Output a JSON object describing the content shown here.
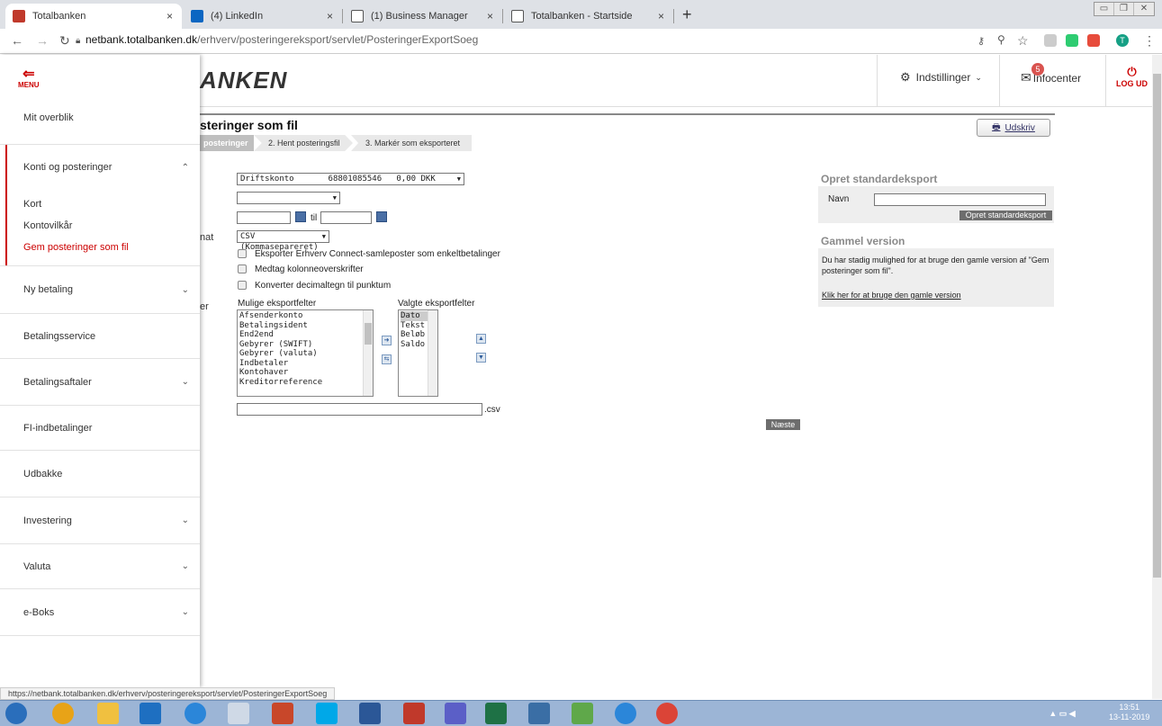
{
  "browser": {
    "tabs": [
      {
        "label": "Totalbanken",
        "color": "#c0392b"
      },
      {
        "label": "(4) LinkedIn",
        "color": "#0a66c2"
      },
      {
        "label": "(1) Business Manager",
        "color": "#555555"
      },
      {
        "label": "Totalbanken - Startside",
        "color": "#555555"
      }
    ],
    "close_glyph": "×",
    "new_tab": "+",
    "url_host": "netbank.totalbanken.dk",
    "url_path": "/erhverv/posteringereksport/servlet/PosteringerExportSoeg",
    "profile_initial": "T"
  },
  "header": {
    "logo": "ANKEN",
    "settings_label": "Indstillinger",
    "infocenter_label": "Infocenter",
    "infocenter_count": "5",
    "logout_label": "LOG UD",
    "menu_label": "MENU"
  },
  "sidebar": {
    "items": [
      {
        "label": "Mit overblik"
      },
      {
        "label": "Konti og posteringer"
      },
      {
        "label": "Ny betaling"
      },
      {
        "label": "Betalingsservice"
      },
      {
        "label": "Betalingsaftaler"
      },
      {
        "label": "FI-indbetalinger"
      },
      {
        "label": "Udbakke"
      },
      {
        "label": "Investering"
      },
      {
        "label": "Valuta"
      },
      {
        "label": "e-Boks"
      }
    ],
    "sub_items": [
      {
        "label": "Kort"
      },
      {
        "label": "Kontovilkår"
      },
      {
        "label": "Gem posteringer som fil"
      }
    ],
    "active_color": "#cc0000"
  },
  "main": {
    "title": "steringer som fil",
    "steps": [
      "posteringer",
      "2. Hent posteringsfil",
      "3. Markér som eksporteret"
    ],
    "print_label": "Udskriv",
    "label_fragment_format": "nat",
    "label_fragment_fields": "er",
    "account_select": "Driftskonto       68801085546   0,00 DKK",
    "date_to_label": "til",
    "format_select": "CSV (Kommasepareret)",
    "checkboxes": [
      "Eksporter Erhverv Connect-samleposter som enkeltbetalinger",
      "Medtag kolonneoverskrifter",
      "Konverter decimaltegn til punktum"
    ],
    "available_fields_label": "Mulige eksportfelter",
    "available_fields": [
      "Afsenderkonto",
      "Betalingsident",
      "End2end",
      "Gebyrer (SWIFT)",
      "Gebyrer (valuta)",
      "Indbetaler",
      "Kontohaver",
      "Kreditorreference"
    ],
    "selected_fields_label": "Valgte eksportfelter",
    "selected_fields": [
      "Dato",
      "Tekst",
      "Beløb",
      "Saldo"
    ],
    "file_ext": ".csv",
    "next_label": "Næste"
  },
  "right_panel": {
    "create_title": "Opret standardeksport",
    "name_label": "Navn",
    "create_button": "Opret standardeksport",
    "old_title": "Gammel version",
    "old_text": "Du har stadig mulighed for at bruge den gamle version af \"Gem posteringer som fil\".",
    "old_link": "Klik her for at bruge den gamle version"
  },
  "status_url": "https://netbank.totalbanken.dk/erhverv/posteringereksport/servlet/PosteringerExportSoeg",
  "taskbar": {
    "time": "13:51",
    "date": "13-11-2019"
  }
}
